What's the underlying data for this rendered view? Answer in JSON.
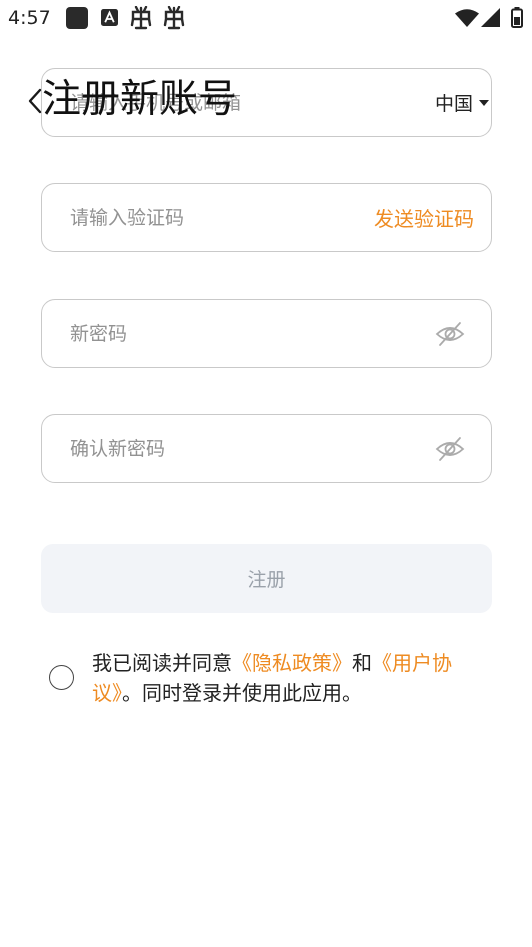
{
  "status_bar": {
    "time": "4:57",
    "icons": [
      "notification-square-icon",
      "app-a-icon",
      "debug-bug-icon",
      "debug-bug-icon",
      "wifi-icon",
      "cell-signal-icon",
      "battery-icon"
    ]
  },
  "header": {
    "back_icon": "chevron-left-icon",
    "title": "注册新账号"
  },
  "form": {
    "account": {
      "placeholder": "请输入手机号或邮箱",
      "region": "中国",
      "region_icon": "caret-down-icon"
    },
    "code": {
      "placeholder": "请输入验证码",
      "send_label": "发送验证码"
    },
    "password": {
      "placeholder": "新密码",
      "toggle_icon": "eye-off-icon"
    },
    "confirm": {
      "placeholder": "确认新密码",
      "toggle_icon": "eye-off-icon"
    },
    "submit_label": "注册"
  },
  "agreement": {
    "checked": false,
    "prefix": "我已阅读并同意",
    "privacy_link": "《隐私政策》",
    "and": "和",
    "terms_link": "《用户协议》",
    "suffix": "。同时登录并使用此应用。"
  },
  "colors": {
    "accent": "#ee8b22",
    "border": "#c9c9c9",
    "button_bg": "#f2f4f8",
    "button_text": "#9aa1aa",
    "placeholder": "#929292"
  }
}
